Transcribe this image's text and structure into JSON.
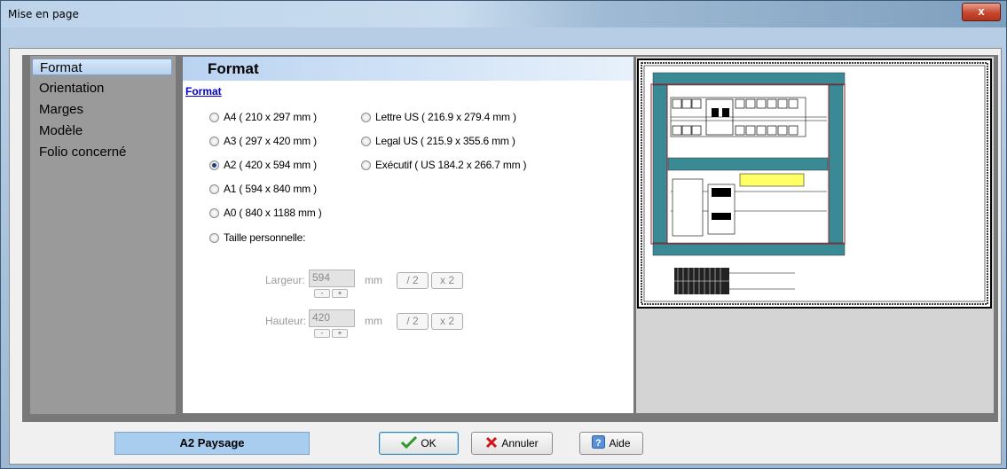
{
  "window": {
    "title": "Mise en page",
    "close_label": "x"
  },
  "sidebar": {
    "items": [
      {
        "label": "Format",
        "selected": true
      },
      {
        "label": "Orientation",
        "selected": false
      },
      {
        "label": "Marges",
        "selected": false
      },
      {
        "label": "Modèle",
        "selected": false
      },
      {
        "label": "Folio concerné",
        "selected": false
      }
    ]
  },
  "panel": {
    "header": "Format",
    "section_title": "Format",
    "formats_left": [
      {
        "label": "A4 ( 210 x 297 mm )",
        "checked": false
      },
      {
        "label": "A3 ( 297 x 420 mm )",
        "checked": false
      },
      {
        "label": "A2 ( 420 x 594 mm )",
        "checked": true
      },
      {
        "label": "A1 ( 594 x 840 mm )",
        "checked": false
      },
      {
        "label": "A0 ( 840 x 1188 mm )",
        "checked": false
      },
      {
        "label": "Taille personnelle:",
        "checked": false
      }
    ],
    "formats_right": [
      {
        "label": "Lettre US ( 216.9 x 279.4 mm )",
        "checked": false
      },
      {
        "label": "Legal US ( 215.9 x 355.6 mm )",
        "checked": false
      },
      {
        "label": "Exécutif ( US 184.2 x 266.7 mm )",
        "checked": false
      }
    ],
    "custom": {
      "width_label": "Largeur:",
      "width_value": "594",
      "height_label": "Hauteur:",
      "height_value": "420",
      "unit": "mm",
      "minus": "-",
      "plus": "+",
      "half_label": "/ 2",
      "double_label": "x 2"
    }
  },
  "footer": {
    "status": "A2 Paysage",
    "ok_label": "OK",
    "cancel_label": "Annuler",
    "help_label": "Aide"
  },
  "colors": {
    "accent": "#a9cdef",
    "preview_frame": "#3a8a96",
    "preview_border": "#9b1b2b",
    "highlight": "#ffff66"
  }
}
